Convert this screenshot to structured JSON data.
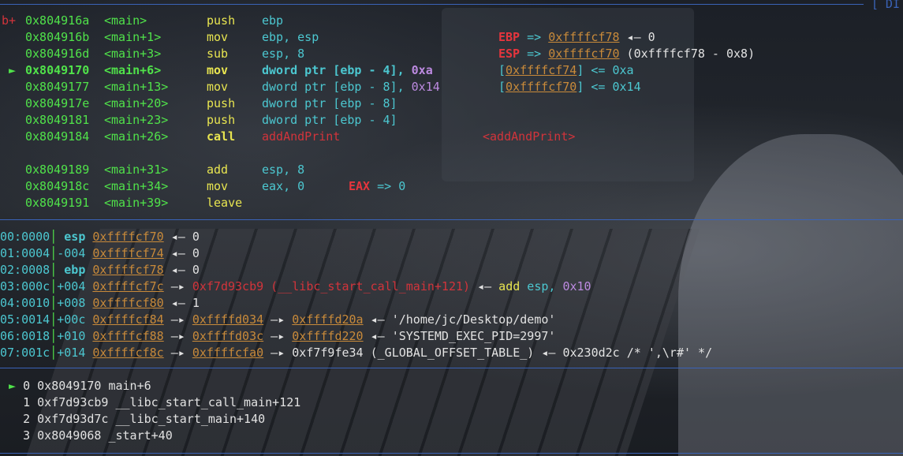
{
  "header": {
    "label": "[ DI"
  },
  "disasm": [
    {
      "prefix": "b+ ",
      "addr": "0x804916a",
      "sym": "<main>",
      "mnem": "push",
      "ops": [
        [
          "ebp",
          "c-cyan"
        ]
      ],
      "note": []
    },
    {
      "prefix": "   ",
      "addr": "0x804916b",
      "sym": "<main+1>",
      "mnem": "mov",
      "ops": [
        [
          "ebp, esp",
          "c-cyan"
        ]
      ],
      "note": [
        [
          "EBP",
          "c-redb"
        ],
        [
          " => ",
          "c-cyan"
        ],
        [
          "0xffffcf78",
          "c-orange"
        ],
        [
          " ◂— 0",
          "c-white"
        ]
      ]
    },
    {
      "prefix": "   ",
      "addr": "0x804916d",
      "sym": "<main+3>",
      "mnem": "sub",
      "ops": [
        [
          "esp, 8",
          "c-cyan"
        ]
      ],
      "note": [
        [
          "ESP",
          "c-redb"
        ],
        [
          " => ",
          "c-cyan"
        ],
        [
          "0xffffcf70",
          "c-orange"
        ],
        [
          " (0xffffcf78 - 0x8)",
          "c-white"
        ]
      ]
    },
    {
      "prefix": " ► ",
      "addr": "0x8049170",
      "sym": "<main+6>",
      "mnem": "mov",
      "ops": [
        [
          "dword ptr [ebp - 4], ",
          "c-cyan"
        ],
        [
          "0xa",
          "c-purple"
        ]
      ],
      "note": [
        [
          "[",
          "c-cyan"
        ],
        [
          "0xffffcf74",
          "c-orange"
        ],
        [
          "] <= 0xa",
          "c-cyan"
        ]
      ],
      "current": true
    },
    {
      "prefix": "   ",
      "addr": "0x8049177",
      "sym": "<main+13>",
      "mnem": "mov",
      "ops": [
        [
          "dword ptr [ebp - 8], ",
          "c-cyan"
        ],
        [
          "0x14",
          "c-purple"
        ]
      ],
      "note": [
        [
          "[",
          "c-cyan"
        ],
        [
          "0xffffcf70",
          "c-orange"
        ],
        [
          "] <= 0x14",
          "c-cyan"
        ]
      ]
    },
    {
      "prefix": "   ",
      "addr": "0x804917e",
      "sym": "<main+20>",
      "mnem": "push",
      "ops": [
        [
          "dword ptr [ebp - 8]",
          "c-cyan"
        ]
      ],
      "note": []
    },
    {
      "prefix": "   ",
      "addr": "0x8049181",
      "sym": "<main+23>",
      "mnem": "push",
      "ops": [
        [
          "dword ptr [ebp - 4]",
          "c-cyan"
        ]
      ],
      "note": []
    },
    {
      "prefix": "   ",
      "addr": "0x8049184",
      "sym": "<main+26>",
      "mnem": "call",
      "ops": [
        [
          "addAndPrint",
          "c-red"
        ]
      ],
      "note": [
        [
          "<addAndPrint>",
          "c-red"
        ]
      ],
      "call": true
    },
    {
      "prefix": "",
      "addr": "",
      "sym": "",
      "mnem": "",
      "ops": [],
      "note": [],
      "blank": true
    },
    {
      "prefix": "   ",
      "addr": "0x8049189",
      "sym": "<main+31>",
      "mnem": "add",
      "ops": [
        [
          "esp, 8",
          "c-cyan"
        ]
      ],
      "note": []
    },
    {
      "prefix": "   ",
      "addr": "0x804918c",
      "sym": "<main+34>",
      "mnem": "mov",
      "ops": [
        [
          "eax, 0",
          "c-cyan"
        ]
      ],
      "note": [
        [
          "EAX",
          "c-redb"
        ],
        [
          " => 0",
          "c-cyan"
        ]
      ],
      "noteShort": true
    },
    {
      "prefix": "   ",
      "addr": "0x8049191",
      "sym": "<main+39>",
      "mnem": "leave",
      "ops": [],
      "note": []
    }
  ],
  "stack": [
    [
      [
        "00:0000",
        "c-cyan"
      ],
      [
        "│ ",
        "c-green"
      ],
      [
        "esp ",
        "c-cyan bold"
      ],
      [
        "0xffffcf70",
        "c-orange"
      ],
      [
        " ◂— 0",
        "c-white"
      ]
    ],
    [
      [
        "01:0004",
        "c-cyan"
      ],
      [
        "│",
        "c-green"
      ],
      [
        "-004 ",
        "c-cyan"
      ],
      [
        "0xffffcf74",
        "c-orange"
      ],
      [
        " ◂— 0",
        "c-white"
      ]
    ],
    [
      [
        "02:0008",
        "c-cyan"
      ],
      [
        "│ ",
        "c-green"
      ],
      [
        "ebp ",
        "c-cyan bold"
      ],
      [
        "0xffffcf78",
        "c-orange"
      ],
      [
        " ◂— 0",
        "c-white"
      ]
    ],
    [
      [
        "03:000c",
        "c-cyan"
      ],
      [
        "│",
        "c-green"
      ],
      [
        "+004 ",
        "c-cyan"
      ],
      [
        "0xffffcf7c",
        "c-orange"
      ],
      [
        " —▸ ",
        "c-white"
      ],
      [
        "0xf7d93cb9 (__libc_start_call_main+121)",
        "c-red"
      ],
      [
        " ◂— ",
        "c-white"
      ],
      [
        "add ",
        "c-yellow"
      ],
      [
        "esp, ",
        "c-cyan"
      ],
      [
        "0x10",
        "c-purple"
      ]
    ],
    [
      [
        "04:0010",
        "c-cyan"
      ],
      [
        "│",
        "c-green"
      ],
      [
        "+008 ",
        "c-cyan"
      ],
      [
        "0xffffcf80",
        "c-orange"
      ],
      [
        " ◂— 1",
        "c-white"
      ]
    ],
    [
      [
        "05:0014",
        "c-cyan"
      ],
      [
        "│",
        "c-green"
      ],
      [
        "+00c ",
        "c-cyan"
      ],
      [
        "0xffffcf84",
        "c-orange"
      ],
      [
        " —▸ ",
        "c-white"
      ],
      [
        "0xffffd034",
        "c-orange"
      ],
      [
        " —▸ ",
        "c-white"
      ],
      [
        "0xffffd20a",
        "c-orange"
      ],
      [
        " ◂— '/home/jc/Desktop/demo'",
        "c-white"
      ]
    ],
    [
      [
        "06:0018",
        "c-cyan"
      ],
      [
        "│",
        "c-green"
      ],
      [
        "+010 ",
        "c-cyan"
      ],
      [
        "0xffffcf88",
        "c-orange"
      ],
      [
        " —▸ ",
        "c-white"
      ],
      [
        "0xffffd03c",
        "c-orange"
      ],
      [
        " —▸ ",
        "c-white"
      ],
      [
        "0xffffd220",
        "c-orange"
      ],
      [
        " ◂— 'SYSTEMD_EXEC_PID=2997'",
        "c-white"
      ]
    ],
    [
      [
        "07:001c",
        "c-cyan"
      ],
      [
        "│",
        "c-green"
      ],
      [
        "+014 ",
        "c-cyan"
      ],
      [
        "0xffffcf8c",
        "c-orange"
      ],
      [
        " —▸ ",
        "c-white"
      ],
      [
        "0xffffcfa0",
        "c-orange"
      ],
      [
        " —▸ 0xf7f9fe34 (_GLOBAL_OFFSET_TABLE_) ◂— 0x230d2c /* ',\\r#' */",
        "c-white"
      ]
    ]
  ],
  "backtrace": [
    [
      [
        " ► ",
        "c-green"
      ],
      [
        "0 ",
        "c-white"
      ],
      [
        "0x8049170 main+6",
        "c-white"
      ]
    ],
    [
      [
        "   ",
        "c-white"
      ],
      [
        "1 ",
        "c-white"
      ],
      [
        "0xf7d93cb9 __libc_start_call_main+121",
        "c-white"
      ]
    ],
    [
      [
        "   ",
        "c-white"
      ],
      [
        "2 ",
        "c-white"
      ],
      [
        "0xf7d93d7c __libc_start_main+140",
        "c-white"
      ]
    ],
    [
      [
        "   ",
        "c-white"
      ],
      [
        "3 ",
        "c-white"
      ],
      [
        "0x8049068 _start+40",
        "c-white"
      ]
    ]
  ]
}
